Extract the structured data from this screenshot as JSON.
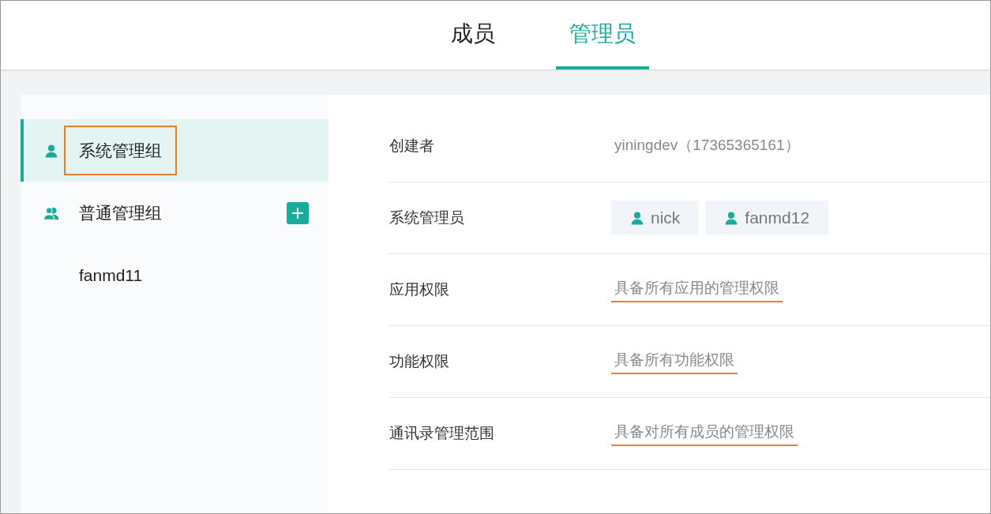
{
  "tabs": [
    {
      "label": "成员",
      "selected": false
    },
    {
      "label": "管理员",
      "selected": true
    }
  ],
  "sidebar": {
    "items": [
      {
        "kind": "single",
        "label": "系统管理组",
        "selected": true,
        "annotated": true,
        "add_button": false
      },
      {
        "kind": "group",
        "label": "普通管理组",
        "selected": false,
        "annotated": false,
        "add_button": true
      },
      {
        "kind": "plain",
        "label": "fanmd11",
        "selected": false,
        "annotated": false,
        "add_button": false
      }
    ]
  },
  "details": [
    {
      "kind": "text",
      "label": "创建者",
      "value": "yiningdev（17365365161）",
      "underlined": false
    },
    {
      "kind": "users",
      "label": "系统管理员",
      "users": [
        "nick",
        "fanmd12"
      ]
    },
    {
      "kind": "text",
      "label": "应用权限",
      "value": "具备所有应用的管理权限",
      "underlined": true
    },
    {
      "kind": "text",
      "label": "功能权限",
      "value": "具备所有功能权限",
      "underlined": true
    },
    {
      "kind": "text",
      "label": "通讯录管理范围",
      "value": "具备对所有成员的管理权限",
      "underlined": true
    }
  ]
}
